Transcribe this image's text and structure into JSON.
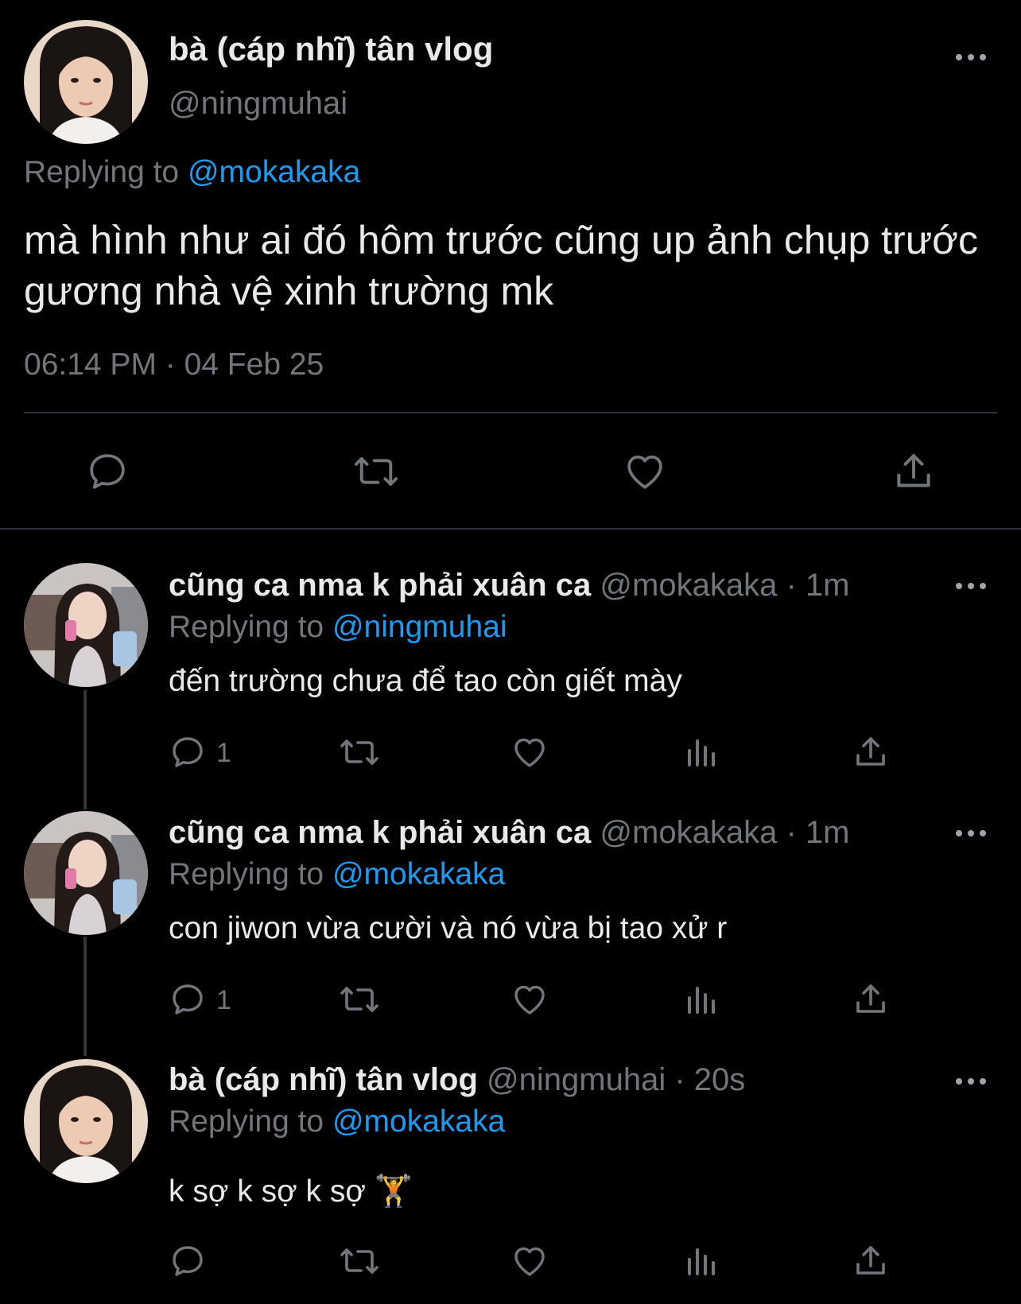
{
  "main_tweet": {
    "author_name": "bà (cáp nhĩ) tân vlog",
    "author_handle": "@ningmuhai",
    "replying_prefix": "Replying to ",
    "replying_to": "@mokakaka",
    "text": "mà hình như ai đó hôm trước cũng up ảnh chụp trước gương nhà vệ xinh trường mk",
    "timestamp": "06:14 PM · 04 Feb 25",
    "actions": [
      "reply-icon",
      "retweet-icon",
      "like-icon",
      "share-icon"
    ]
  },
  "replies": [
    {
      "author_name": "cũng ca nma k phải xuân ca",
      "author_handle": "@mokakaka",
      "time": "· 1m",
      "replying_prefix": "Replying to ",
      "replying_to": "@ningmuhai",
      "text": "đến trường chưa để tao còn giết mày",
      "reply_count": "1"
    },
    {
      "author_name": "cũng ca nma k phải xuân ca",
      "author_handle": "@mokakaka",
      "time": "· 1m",
      "replying_prefix": "Replying to ",
      "replying_to": "@mokakaka",
      "text": "con jiwon vừa cười và nó vừa bị tao xử r",
      "reply_count": "1"
    },
    {
      "author_name": "bà (cáp nhĩ) tân vlog",
      "author_handle": "@ningmuhai",
      "time": "· 20s",
      "replying_prefix": "Replying to ",
      "replying_to": "@mokakaka",
      "text": "k sợ k sợ k sợ 🏋",
      "reply_count": ""
    }
  ],
  "colors": {
    "background": "#000000",
    "text": "#e7e9ea",
    "muted": "#71767b",
    "link": "#1d9bf0",
    "divider": "#2f3336"
  }
}
